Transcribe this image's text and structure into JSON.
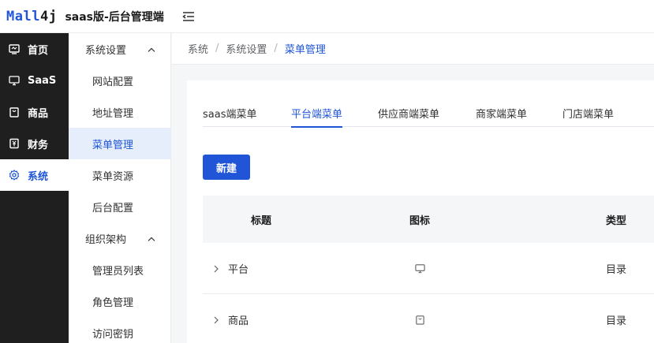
{
  "header": {
    "logo_part1": "Mall",
    "logo_part2": "4j",
    "app_title": "saas版-后台管理端"
  },
  "primary_nav": [
    {
      "label": "首页",
      "icon": "monitor-icon"
    },
    {
      "label": "SaaS",
      "icon": "desktop-icon"
    },
    {
      "label": "商品",
      "icon": "bag-icon"
    },
    {
      "label": "财务",
      "icon": "finance-icon"
    },
    {
      "label": "系统",
      "icon": "gear-icon",
      "active": true
    }
  ],
  "secondary_nav": {
    "group1": "系统设置",
    "group1_items": [
      "网站配置",
      "地址管理",
      "菜单管理",
      "菜单资源",
      "后台配置"
    ],
    "group2": "组织架构",
    "group2_items": [
      "管理员列表",
      "角色管理",
      "访问密钥"
    ]
  },
  "breadcrumb": [
    "系统",
    "系统设置",
    "菜单管理"
  ],
  "tabs": [
    "saas端菜单",
    "平台端菜单",
    "供应商端菜单",
    "商家端菜单",
    "门店端菜单"
  ],
  "active_tab": "平台端菜单",
  "new_button": "新建",
  "table": {
    "columns": [
      "标题",
      "图标",
      "类型"
    ],
    "rows": [
      {
        "title": "平台",
        "icon": "desktop-icon",
        "type": "目录"
      },
      {
        "title": "商品",
        "icon": "bag-icon",
        "type": "目录"
      }
    ]
  },
  "colors": {
    "primary": "#1f55d6",
    "sidebar_dark": "#1f1f1f",
    "active_sub_bg": "#e6edfb"
  }
}
